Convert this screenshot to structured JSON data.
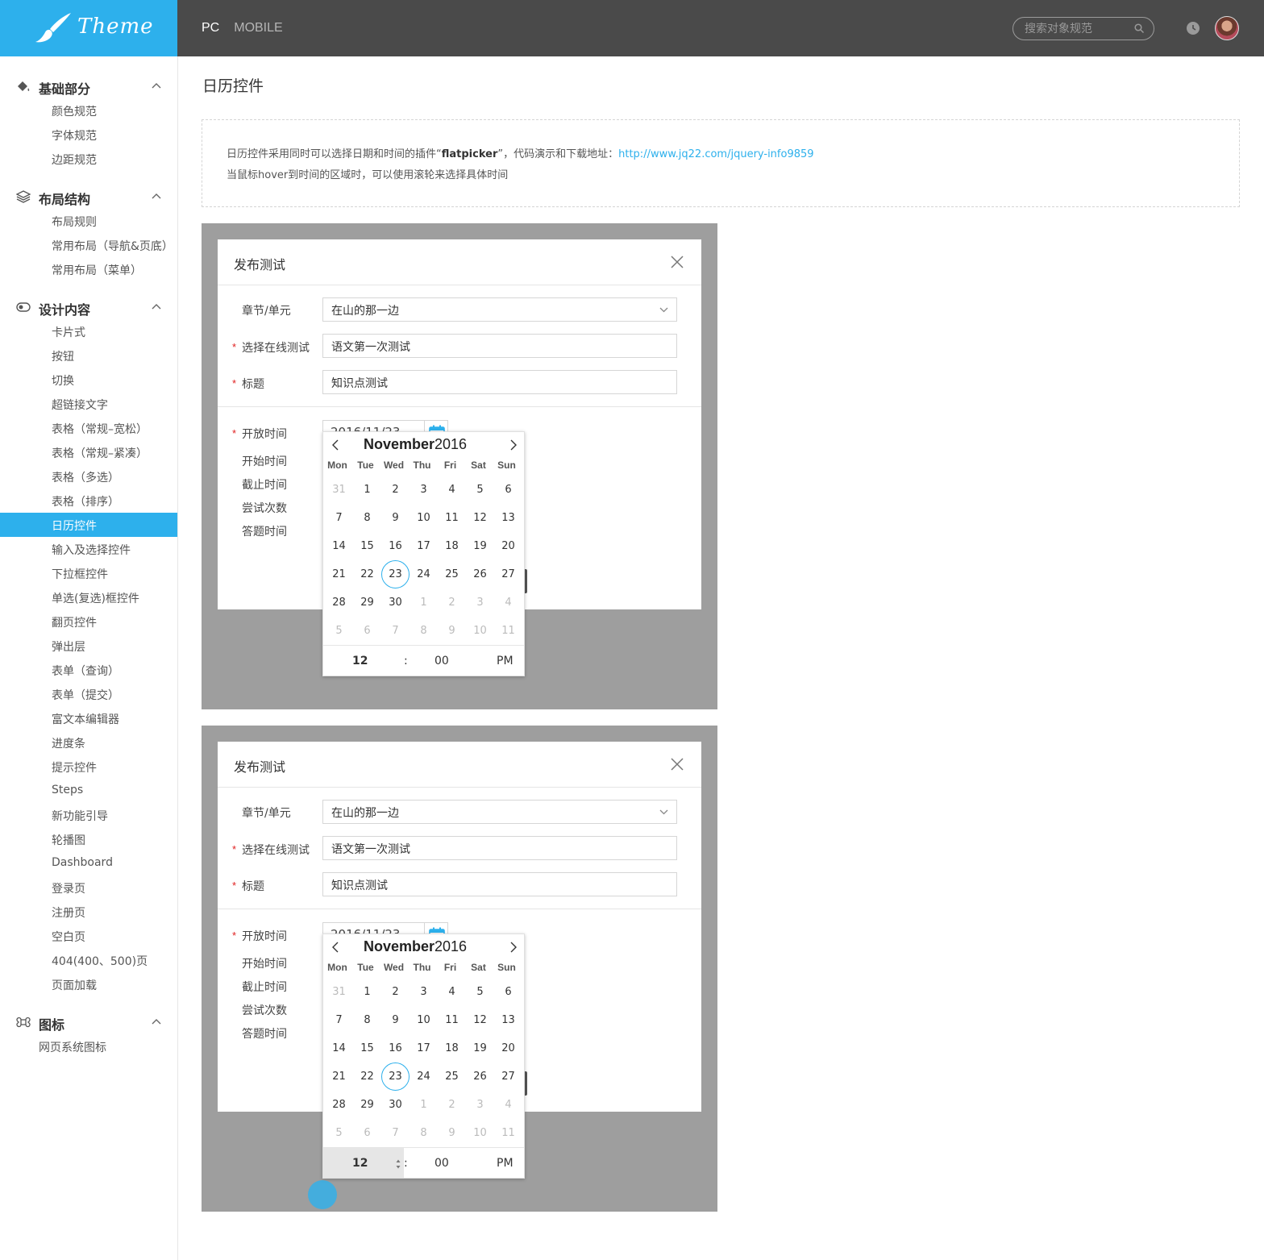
{
  "header": {
    "logo_text": "Theme",
    "nav": [
      "PC",
      "MOBILE"
    ],
    "search_placeholder": "搜索对象规范",
    "icons": [
      "search-icon",
      "clock-icon",
      "avatar"
    ]
  },
  "sidebar": {
    "sections": [
      {
        "title": "基础部分",
        "icon": "paint-bucket-icon",
        "items": [
          "颜色规范",
          "字体规范",
          "边距规范"
        ]
      },
      {
        "title": "布局结构",
        "icon": "layers-icon",
        "items": [
          "布局规则",
          "常用布局（导航&页底）",
          "常用布局（菜单）"
        ]
      },
      {
        "title": "设计内容",
        "icon": "toggle-icon",
        "items": [
          "卡片式",
          "按钮",
          "切换",
          "超链接文字",
          "表格（常规–宽松）",
          "表格（常规–紧凑）",
          "表格（多选）",
          "表格（排序）",
          "日历控件",
          "输入及选择控件",
          "下拉框控件",
          "单选(复选)框控件",
          "翻页控件",
          "弹出层",
          "表单（查询）",
          "表单（提交）",
          "富文本编辑器",
          "进度条",
          "提示控件",
          "Steps",
          "新功能引导",
          "轮播图",
          "Dashboard",
          "登录页",
          "注册页",
          "空白页",
          "404(400、500)页",
          "页面加载"
        ]
      },
      {
        "title": "图标",
        "icon": "command-icon",
        "items": [
          "网页系统图标"
        ]
      }
    ],
    "active_item": "日历控件"
  },
  "main": {
    "title": "日历控件",
    "desc_line1_prefix": "日历控件采用同时可以选择日期和时间的插件“",
    "desc_line1_bold": "flatpicker",
    "desc_line1_mid": "”，代码演示和下载地址：",
    "desc_link": "http://www.jq22.com/jquery-info9859",
    "desc_line2": "当鼠标hover到时间的区域时，可以使用滚轮来选择具体时间"
  },
  "dialog": {
    "title": "发布测试",
    "labels": {
      "chapter": "章节/单元",
      "online_test": "选择在线测试",
      "heading": "标题",
      "open_time": "开放时间",
      "start_time": "开始时间",
      "end_time": "截止时间",
      "attempts": "尝试次数",
      "answer_time": "答题时间"
    },
    "values": {
      "chapter": "在山的那一边",
      "online_test": "语文第一次测试",
      "heading": "知识点测试",
      "date": "2016/11/23"
    }
  },
  "picker": {
    "month": "November",
    "year": "2016",
    "weekdays": [
      "Mon",
      "Tue",
      "Wed",
      "Thu",
      "Fri",
      "Sat",
      "Sun"
    ],
    "days": [
      [
        "31",
        "1",
        "2",
        "3",
        "4",
        "5",
        "6"
      ],
      [
        "7",
        "8",
        "9",
        "10",
        "11",
        "12",
        "13"
      ],
      [
        "14",
        "15",
        "16",
        "17",
        "18",
        "19",
        "20"
      ],
      [
        "21",
        "22",
        "23",
        "24",
        "25",
        "26",
        "27"
      ],
      [
        "28",
        "29",
        "30",
        "1",
        "2",
        "3",
        "4"
      ],
      [
        "5",
        "6",
        "7",
        "8",
        "9",
        "10",
        "11"
      ]
    ],
    "selected_day": "23",
    "hour": "12",
    "separator": ":",
    "minute": "00",
    "ampm": "PM"
  },
  "colors": {
    "accent": "#2db0ec",
    "header_bg": "#4a4a4a",
    "required": "#e02020",
    "demo_bg": "#9e9e9e"
  }
}
